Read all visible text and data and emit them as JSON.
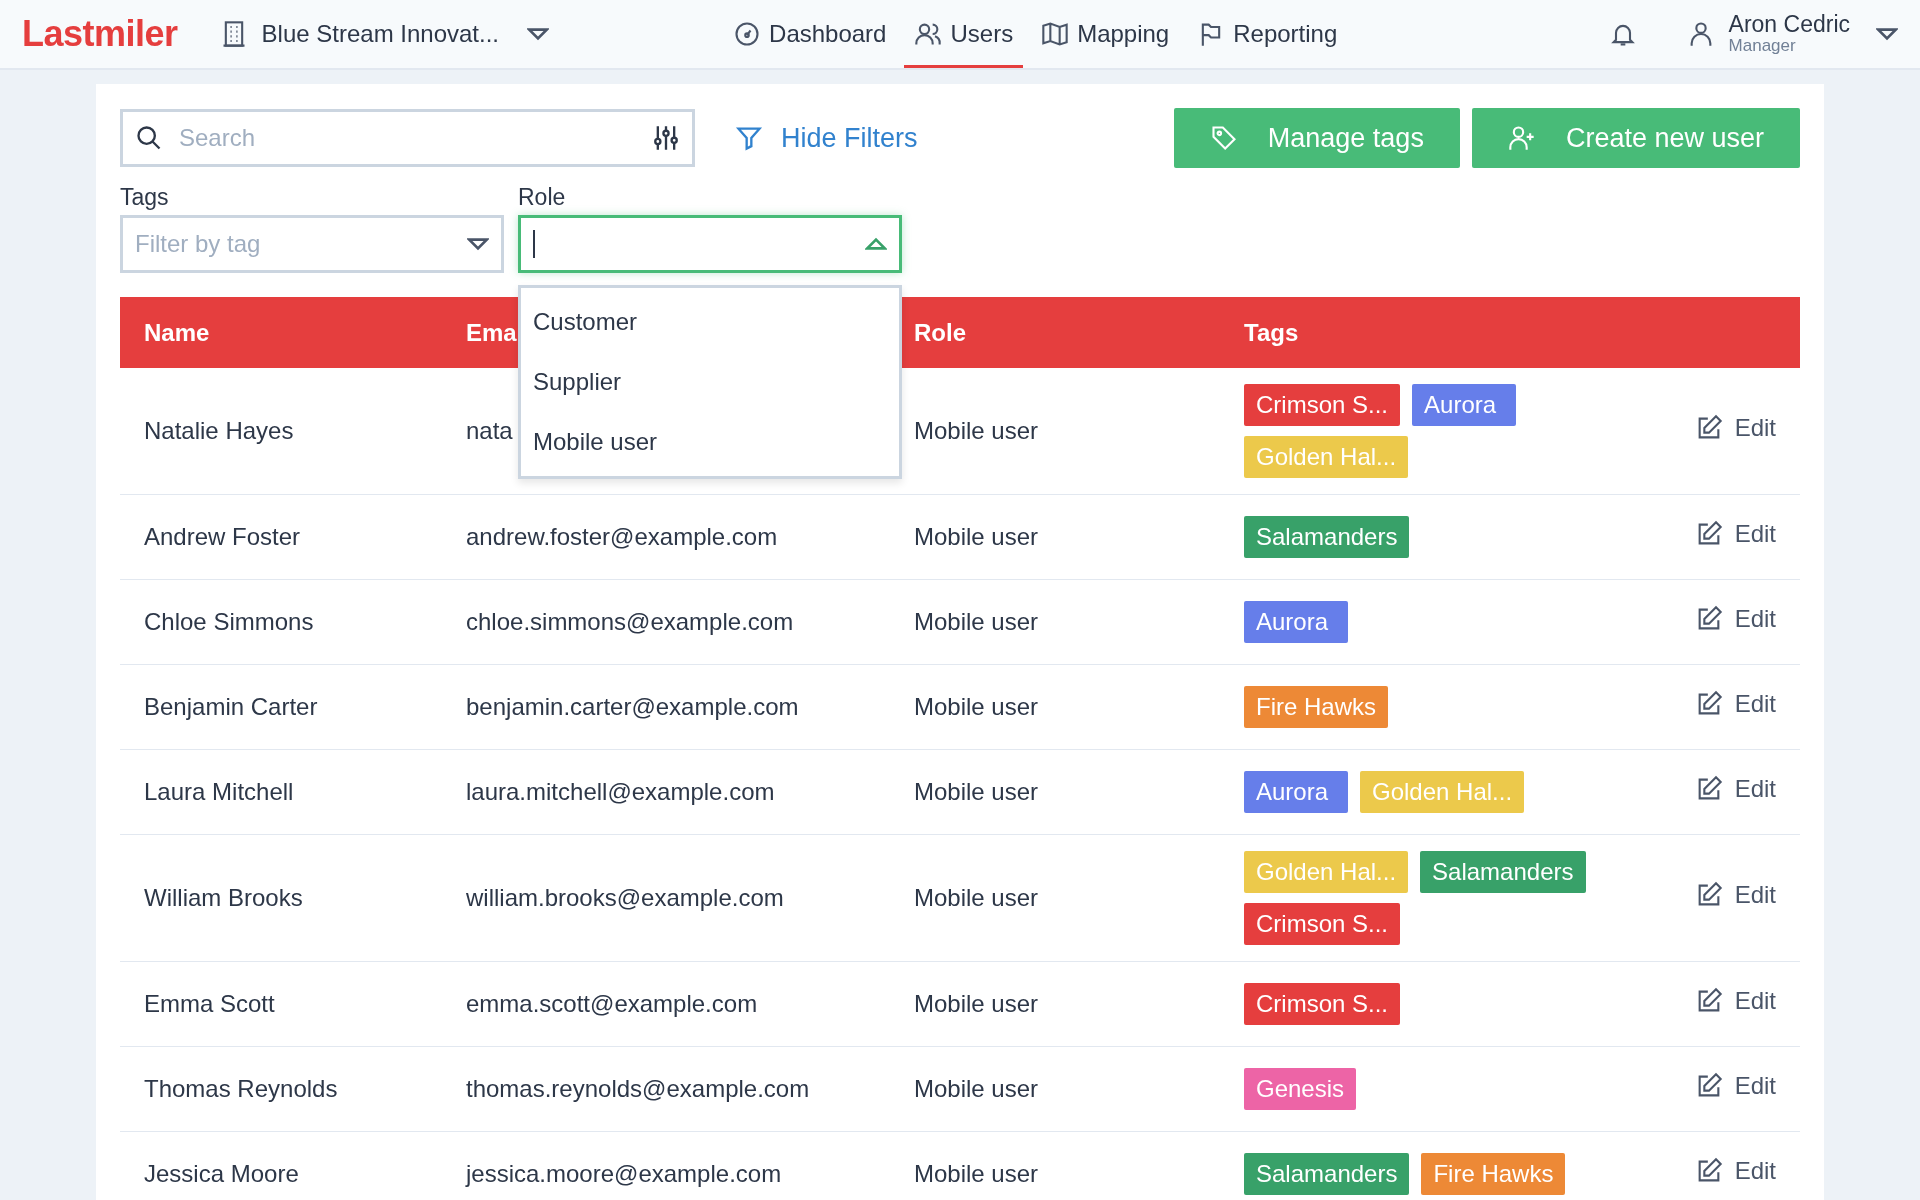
{
  "header": {
    "logo": "Lastmiler",
    "organization": "Blue Stream Innovat...",
    "nav": [
      {
        "label": "Dashboard",
        "selected": false
      },
      {
        "label": "Users",
        "selected": true
      },
      {
        "label": "Mapping",
        "selected": false
      },
      {
        "label": "Reporting",
        "selected": false
      }
    ],
    "user": {
      "name": "Aron Cedric",
      "role": "Manager"
    }
  },
  "toolbar": {
    "search": {
      "placeholder": "Search"
    },
    "hide_filters": "Hide Filters",
    "buttons": [
      "Manage tags",
      "Create new user"
    ]
  },
  "filters": {
    "tags": {
      "label": "Tags",
      "placeholder": "Filter by tag"
    },
    "role": {
      "label": "Role",
      "open": true,
      "options": [
        "Customer",
        "Supplier",
        "Mobile user"
      ]
    }
  },
  "table": {
    "columns": [
      "Name",
      "Ema",
      "Role",
      "Tags"
    ],
    "rows": [
      {
        "name": "Natalie Hayes",
        "email": "nata",
        "role": "Mobile user",
        "edit": "Edit",
        "tags": [
          {
            "label": "Crimson S...",
            "color": "#e53e3e"
          },
          {
            "label": "Aurora",
            "color": "#667eea"
          },
          {
            "label": "Golden Hal...",
            "color": "#ecc94b"
          }
        ]
      },
      {
        "name": "Andrew Foster",
        "email": "andrew.foster@example.com",
        "role": "Mobile user",
        "edit": "Edit",
        "tags": [
          {
            "label": "Salamanders",
            "color": "#38a169"
          }
        ]
      },
      {
        "name": "Chloe Simmons",
        "email": "chloe.simmons@example.com",
        "role": "Mobile user",
        "edit": "Edit",
        "tags": [
          {
            "label": "Aurora",
            "color": "#667eea"
          }
        ]
      },
      {
        "name": "Benjamin Carter",
        "email": "benjamin.carter@example.com",
        "role": "Mobile user",
        "edit": "Edit",
        "tags": [
          {
            "label": "Fire Hawks",
            "color": "#ed8936"
          }
        ]
      },
      {
        "name": "Laura Mitchell",
        "email": "laura.mitchell@example.com",
        "role": "Mobile user",
        "edit": "Edit",
        "tags": [
          {
            "label": "Aurora",
            "color": "#667eea"
          },
          {
            "label": "Golden Hal...",
            "color": "#ecc94b"
          }
        ]
      },
      {
        "name": "William Brooks",
        "email": "william.brooks@example.com",
        "role": "Mobile user",
        "edit": "Edit",
        "tags": [
          {
            "label": "Golden Hal...",
            "color": "#ecc94b"
          },
          {
            "label": "Salamanders",
            "color": "#38a169"
          },
          {
            "label": "Crimson S...",
            "color": "#e53e3e"
          }
        ]
      },
      {
        "name": "Emma Scott",
        "email": "emma.scott@example.com",
        "role": "Mobile user",
        "edit": "Edit",
        "tags": [
          {
            "label": "Crimson S...",
            "color": "#e53e3e"
          }
        ]
      },
      {
        "name": "Thomas Reynolds",
        "email": "thomas.reynolds@example.com",
        "role": "Mobile user",
        "edit": "Edit",
        "tags": [
          {
            "label": "Genesis",
            "color": "#ed64a6"
          }
        ]
      },
      {
        "name": "Jessica Moore",
        "email": "jessica.moore@example.com",
        "role": "Mobile user",
        "edit": "Edit",
        "tags": [
          {
            "label": "Salamanders",
            "color": "#38a169"
          },
          {
            "label": "Fire Hawks",
            "color": "#ed8936"
          }
        ]
      }
    ]
  }
}
